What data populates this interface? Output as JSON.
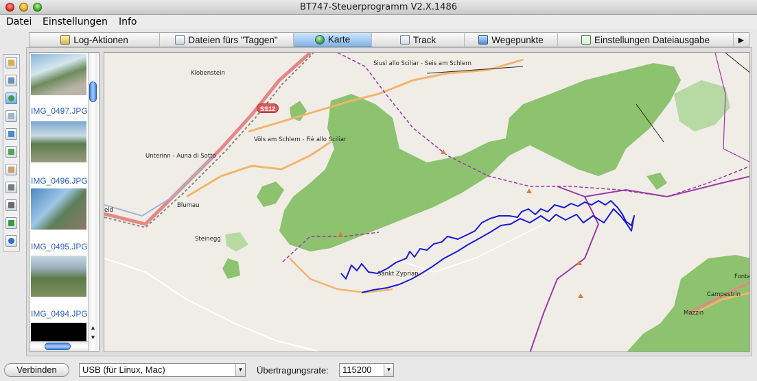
{
  "window": {
    "title": "BT747-Steuerprogramm V2.X.1486"
  },
  "menu": [
    "Datei",
    "Einstellungen",
    "Info"
  ],
  "tabs": [
    {
      "label": "Log-Aktionen",
      "icon": "house-icon"
    },
    {
      "label": "Dateien fürs \"Taggen\"",
      "icon": "files-icon"
    },
    {
      "label": "Karte",
      "icon": "globe-icon",
      "active": true
    },
    {
      "label": "Track",
      "icon": "table-icon"
    },
    {
      "label": "Wegepunkte",
      "icon": "flag-icon"
    },
    {
      "label": "Einstellungen Dateiausgabe",
      "icon": "document-icon"
    }
  ],
  "sidebar_tools": [
    "house-icon",
    "files-icon",
    "globe-icon",
    "table-icon",
    "flag-icon",
    "document-icon",
    "hourglass-icon",
    "wrench-icon",
    "wrench-plus-icon",
    "export-icon",
    "info-icon"
  ],
  "thumbnails": [
    {
      "label": "IMG_0497.JPG"
    },
    {
      "label": "IMG_0496.JPG"
    },
    {
      "label": "IMG_0495.JPG"
    },
    {
      "label": "IMG_0494.JPG"
    }
  ],
  "map": {
    "road_shield": "SS12",
    "labels": {
      "klobenstein": "Klobenstein",
      "siusi": "Siusi allo Sciliar - Seis am Schlern",
      "voels": "Völs am Schlern - Fiè allo Sciliar",
      "unterinn": "Unterinn - Auna di Sotto",
      "blumau": "Blumau",
      "steinegg": "Steinegg",
      "zyprian": "Sankt Zyprian",
      "campestrin": "Campestrin",
      "mazzin": "Mazzin",
      "fonta": "Fonta",
      "eid": "eid"
    },
    "colors": {
      "track": "#1a1ad6",
      "forest": "#8dc26f",
      "road": "#f3b46c",
      "boundary": "#9a3aa6"
    }
  },
  "bottom": {
    "connect_label": "Verbinden",
    "port_value": "USB (für Linux, Mac)",
    "rate_label": "Übertragungsrate:",
    "rate_value": "115200"
  }
}
